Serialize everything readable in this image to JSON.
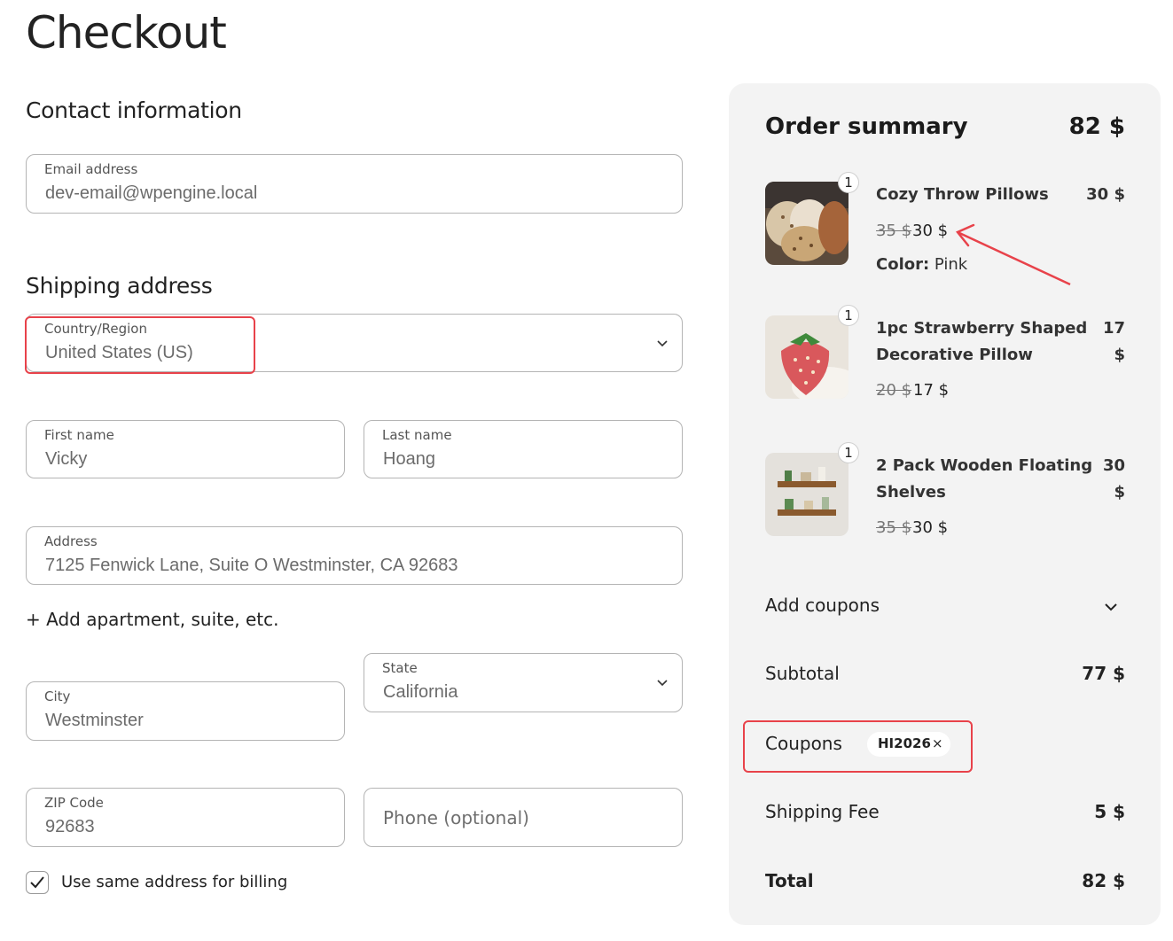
{
  "page_title": "Checkout",
  "contact": {
    "section_title": "Contact information",
    "email_label": "Email address",
    "email_value": "dev-email@wpengine.local"
  },
  "shipping": {
    "section_title": "Shipping address",
    "country_label": "Country/Region",
    "country_value": "United States (US)",
    "first_name_label": "First name",
    "first_name_value": "Vicky",
    "last_name_label": "Last name",
    "last_name_value": "Hoang",
    "address_label": "Address",
    "address_value": "7125 Fenwick Lane, Suite O Westminster, CA 92683",
    "add_apartment": "+ Add apartment, suite, etc.",
    "city_label": "City",
    "city_value": "Westminster",
    "state_label": "State",
    "state_value": "California",
    "zip_label": "ZIP Code",
    "zip_value": "92683",
    "phone_placeholder": "Phone (optional)",
    "billing_checkbox_label": "Use same address for billing",
    "billing_checked": true
  },
  "summary": {
    "title": "Order summary",
    "total_header": "82 $",
    "items": [
      {
        "qty": "1",
        "name_line1": "Cozy Throw Pillows",
        "name_line2": "",
        "price_line1": "30 $",
        "price_line2": "",
        "old_price": "35 $",
        "new_price": "30 $",
        "color_label": "Color:",
        "color_value": " Pink"
      },
      {
        "qty": "1",
        "name_line1": "1pc Strawberry Shaped",
        "name_line2": "Decorative Pillow",
        "price_line1": "17",
        "price_line2": "$",
        "old_price": "20 $",
        "new_price": "17 $"
      },
      {
        "qty": "1",
        "name_line1": "2 Pack Wooden Floating",
        "name_line2": "Shelves",
        "price_line1": "30",
        "price_line2": "$",
        "old_price": "35 $",
        "new_price": "30 $"
      }
    ],
    "add_coupons_label": "Add coupons",
    "subtotal_label": "Subtotal",
    "subtotal_value": "77 $",
    "coupons_label": "Coupons",
    "coupon_code": "HI2026",
    "coupon_remove": "×",
    "shipping_label": "Shipping Fee",
    "shipping_value": "5 $",
    "total_label": "Total",
    "total_value": "82 $"
  },
  "colors": {
    "annotation_red": "#e8424a",
    "summary_bg": "#f3f3f3"
  }
}
